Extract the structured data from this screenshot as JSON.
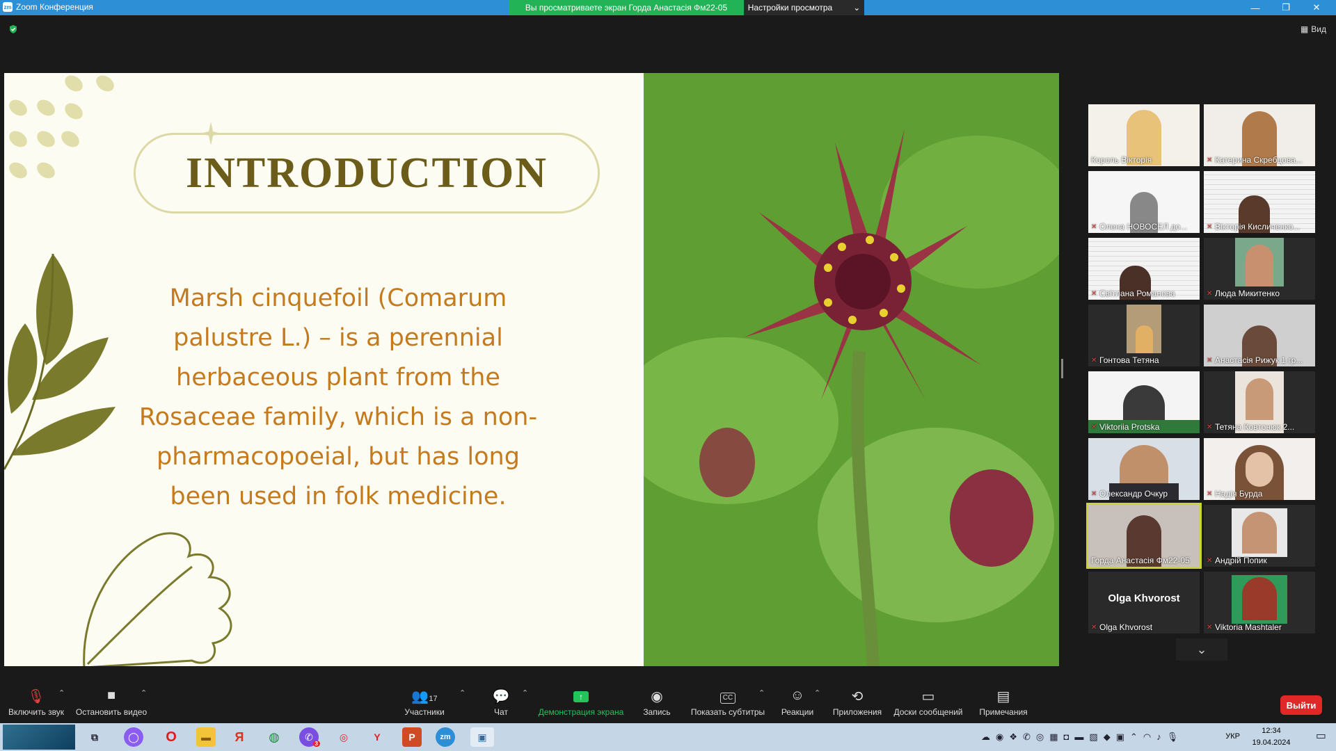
{
  "window": {
    "app_title": "Zoom Конференция",
    "share_banner": "Вы просматриваете экран Горда Анастасія Фм22-05",
    "view_settings": "Настройки просмотра",
    "view_button": "Вид"
  },
  "slide": {
    "title": "INTRODUCTION",
    "lines": [
      "Marsh cinquefoil (Comarum",
      "palustre L.) – is a perennial",
      "herbaceous plant from the",
      "Rosaceae family, which is a non-",
      "pharmacopoeial, but has long",
      "been used in folk medicine."
    ]
  },
  "participants": [
    {
      "name": "Король Вікторія",
      "muted": false
    },
    {
      "name": "Катерина Скребцова...",
      "muted": true
    },
    {
      "name": "Олена НОВОСЕЛ до...",
      "muted": true
    },
    {
      "name": "Вікторія Кисличенко...",
      "muted": true
    },
    {
      "name": "Світлана Романова",
      "muted": true
    },
    {
      "name": "Люда Микитенко",
      "muted": true
    },
    {
      "name": "Гонтова Тетяна",
      "muted": true
    },
    {
      "name": "Анастасія Рижук 1 гр...",
      "muted": true
    },
    {
      "name": "Viktoriia Protska",
      "muted": true
    },
    {
      "name": "Тетяна Ковтонюк 2...",
      "muted": true
    },
    {
      "name": "Олександр Очкур",
      "muted": true
    },
    {
      "name": "Надія Бурда",
      "muted": true
    },
    {
      "name": "Горда Анастасія Фм22-05",
      "muted": false
    },
    {
      "name": "Андрій Попик",
      "muted": true
    },
    {
      "name": "Olga Khvorost",
      "muted": true
    },
    {
      "name": "Viktoria Mashtaler",
      "muted": true
    }
  ],
  "tile_center_name": "Olga Khvorost",
  "toolbar": {
    "unmute": "Включить звук",
    "stop_video": "Остановить видео",
    "participants": "Участники",
    "participants_count": "17",
    "chat": "Чат",
    "share": "Демонстрация экрана",
    "record": "Запись",
    "captions": "Показать субтитры",
    "reactions": "Реакции",
    "apps": "Приложения",
    "whiteboards": "Доски сообщений",
    "notes": "Примечания",
    "leave": "Выйти"
  },
  "taskbar": {
    "lang": "УКР",
    "time": "12:34",
    "date": "19.04.2024",
    "viber_badge": "3"
  },
  "colors": {
    "accent_green": "#21b356",
    "leave_red": "#e02828",
    "slide_title": "#6b5c1a",
    "slide_text": "#c47a1e"
  }
}
